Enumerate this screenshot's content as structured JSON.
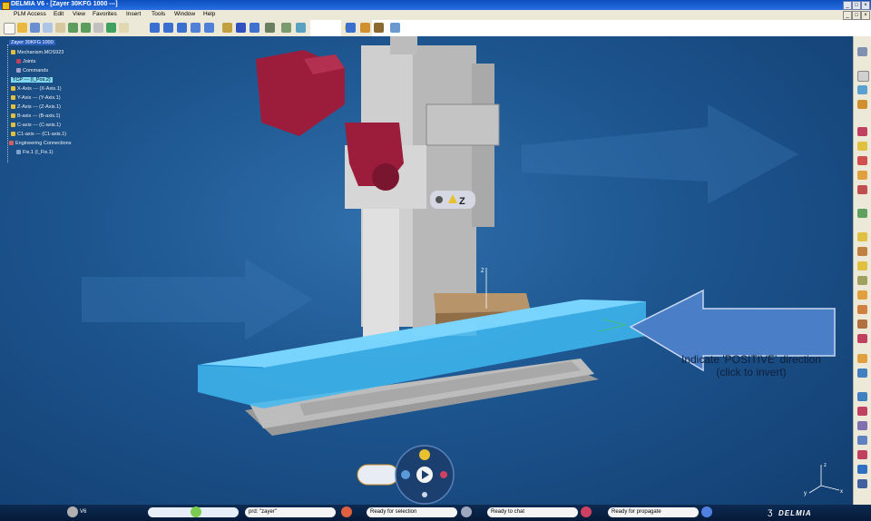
{
  "window": {
    "title": "DELMIA V6 - [Zayer 30KFG 1000 ---]",
    "minimize": "_",
    "maximize": "□",
    "close": "×"
  },
  "menu": [
    "PLM Access",
    "Edit",
    "View",
    "Favorites",
    "Insert",
    "Tools",
    "Window",
    "Help"
  ],
  "tree": {
    "root": "Zayer 30KFG 1000",
    "mechanism": "Mechanism.MOS923",
    "items": [
      "Joints",
      "Commands",
      "TCP --- (I_Pos.2)",
      "X-Axis --- (X-Axis.1)",
      "Y-Axis --- (Y-Axis.1)",
      "Z-Axis --- (Z-Axis.1)",
      "B-axis --- (B-axis.1)",
      "C-axis --- (C-axis.1)",
      "C1-axis --- (C1-axis.1)",
      "Engineering Connections",
      "Fix.1 (I_Fix.1)"
    ]
  },
  "robot_compass_label": "Z",
  "hint": {
    "line1": "Indicate 'POSITIVE' direction",
    "line2": "(click to invert)"
  },
  "status": {
    "version": "V6",
    "search": "prd: \"zayer\"",
    "selection": "Ready for selection",
    "chat": "Ready to chat",
    "propagate": "Ready for propagate"
  },
  "logo": "DELMIA",
  "axes_labels": {
    "x": "x",
    "y": "y",
    "z": "z"
  },
  "colors": {
    "accent": "#1f5ea5",
    "highlight": "#3fb8f0",
    "robot_arm": "#9c1c3c",
    "machine": "#c4c4c4"
  }
}
